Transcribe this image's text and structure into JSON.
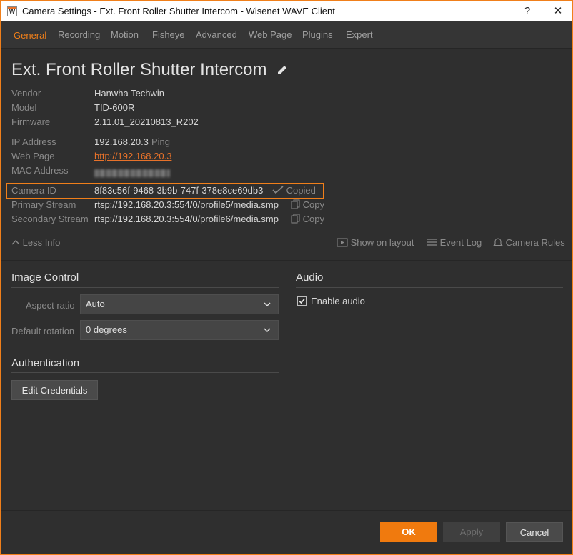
{
  "window": {
    "title": "Camera Settings - Ext. Front Roller Shutter Intercom - Wisenet WAVE Client",
    "help_label": "?",
    "close_label": "✕"
  },
  "tabs": [
    {
      "label": "General"
    },
    {
      "label": "Recording"
    },
    {
      "label": "Motion"
    },
    {
      "label": "Fisheye"
    },
    {
      "label": "Advanced"
    },
    {
      "label": "Web Page"
    },
    {
      "label": "Plugins"
    },
    {
      "label": "Expert"
    }
  ],
  "camera": {
    "name": "Ext. Front Roller Shutter Intercom",
    "vendor_label": "Vendor",
    "vendor": "Hanwha Techwin",
    "model_label": "Model",
    "model": "TID-600R",
    "firmware_label": "Firmware",
    "firmware": "2.11.01_20210813_R202",
    "ip_label": "IP Address",
    "ip": "192.168.20.3",
    "ping_label": "Ping",
    "webpage_label": "Web Page",
    "webpage": "http://192.168.20.3",
    "mac_label": "MAC Address",
    "id_label": "Camera ID",
    "id": "8f83c56f-9468-3b9b-747f-378e8ce69db3",
    "copied_label": "Copied",
    "primary_label": "Primary Stream",
    "primary": "rtsp://192.168.20.3:554/0/profile5/media.smp",
    "secondary_label": "Secondary Stream",
    "secondary": "rtsp://192.168.20.3:554/0/profile6/media.smp",
    "copy_label": "Copy"
  },
  "info_actions": {
    "less_info": "Less Info",
    "show_on_layout": "Show on layout",
    "event_log": "Event Log",
    "camera_rules": "Camera Rules"
  },
  "image_control": {
    "heading": "Image Control",
    "aspect_label": "Aspect ratio",
    "aspect_value": "Auto",
    "rotation_label": "Default rotation",
    "rotation_value": "0 degrees"
  },
  "audio": {
    "heading": "Audio",
    "enable_label": "Enable audio",
    "enabled": true
  },
  "authentication": {
    "heading": "Authentication",
    "edit_label": "Edit Credentials"
  },
  "footer": {
    "ok": "OK",
    "apply": "Apply",
    "cancel": "Cancel"
  },
  "colors": {
    "accent": "#f07f1a",
    "background": "#2f2f2f"
  }
}
